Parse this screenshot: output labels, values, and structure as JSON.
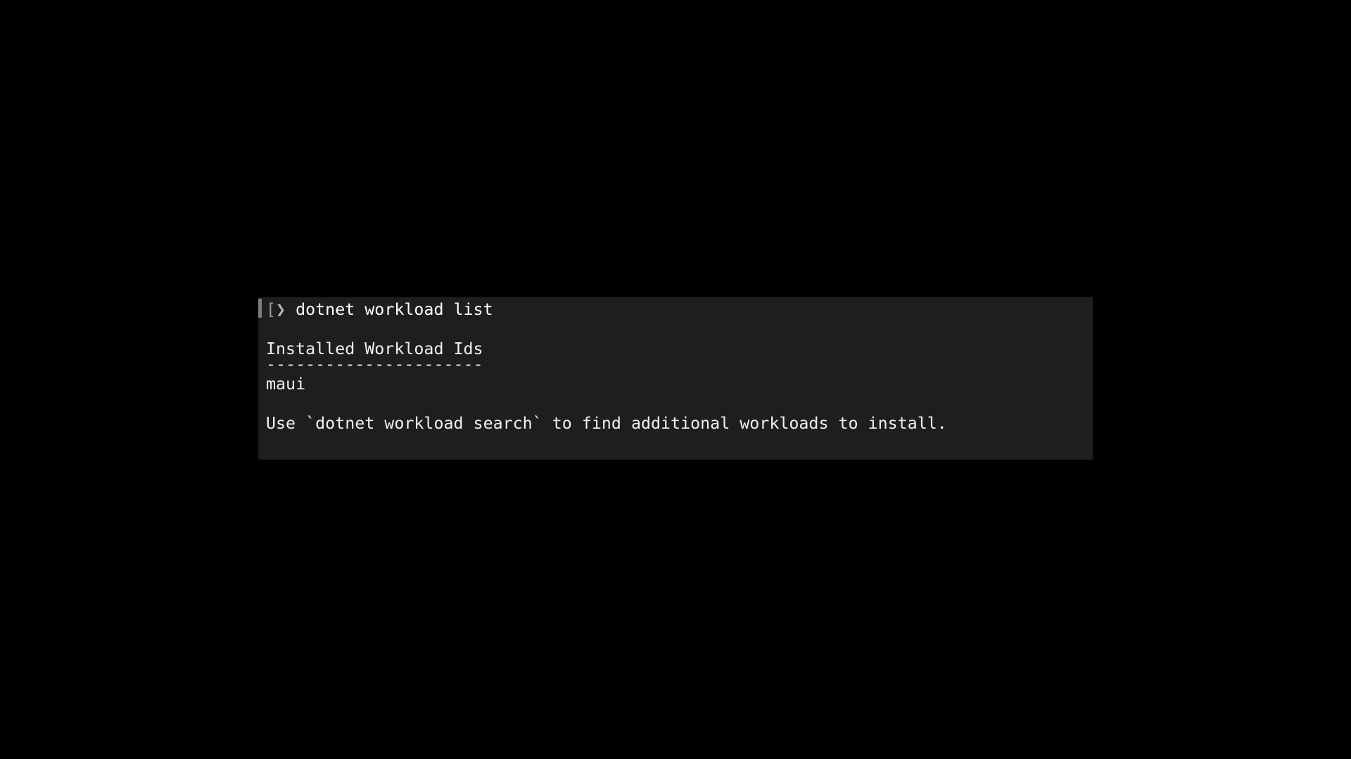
{
  "window": {
    "background_color": "#000000",
    "panel_background_color": "#1e1e1e",
    "text_color": "#f2f2f2"
  },
  "terminal": {
    "cursor": {
      "name": "block-cursor",
      "color": "#7d7d7d",
      "visible": true
    },
    "prompt": {
      "sigil": "[",
      "chevron": "❯",
      "sigil_color": "#9a9a9a",
      "chevron_color": "#b4b4b4"
    },
    "command": "dotnet workload list",
    "output": {
      "blank_1": "",
      "header": "Installed Workload Ids",
      "rule": "----------------------",
      "workloads": [
        "maui"
      ],
      "blank_2": "",
      "footer": "Use `dotnet workload search` to find additional workloads to install."
    }
  }
}
